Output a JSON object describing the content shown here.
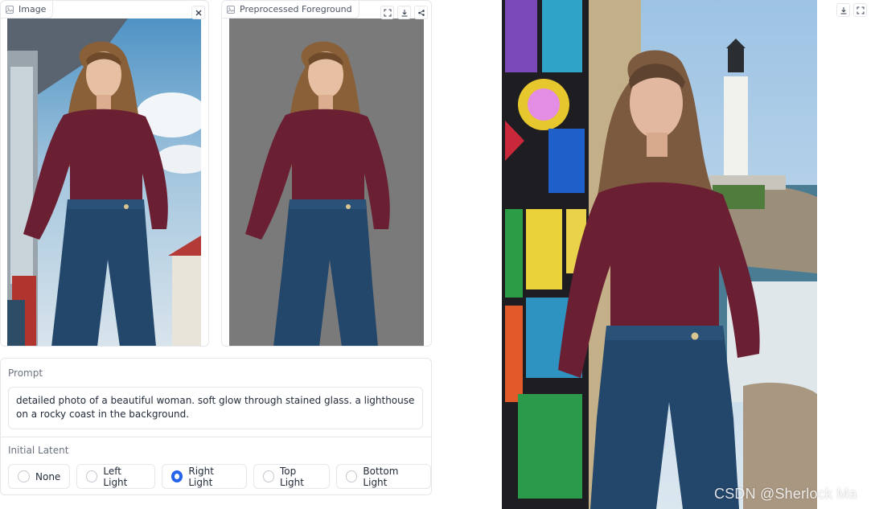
{
  "image_panel": {
    "label": "Image",
    "label_icon": "image-icon",
    "close_icon": "close-icon"
  },
  "foreground_panel": {
    "label": "Preprocessed Foreground",
    "actions": [
      "fullscreen-icon",
      "download-icon",
      "share-icon"
    ]
  },
  "output_panel": {
    "actions": [
      "download-icon",
      "fullscreen-icon"
    ]
  },
  "prompt": {
    "label": "Prompt",
    "value": "detailed photo of a beautiful woman. soft glow through stained glass. a lighthouse on a rocky coast in the background."
  },
  "initial_latent": {
    "label": "Initial Latent",
    "options": [
      "None",
      "Left Light",
      "Right Light",
      "Top Light",
      "Bottom Light"
    ],
    "selected": "Right Light"
  },
  "watermark": "CSDN @Sherlock  Ma",
  "colors": {
    "accent": "#2563eb",
    "sweater": "#6b1f33",
    "jeans": "#23466b",
    "gray_bg": "#7a7a7a"
  }
}
